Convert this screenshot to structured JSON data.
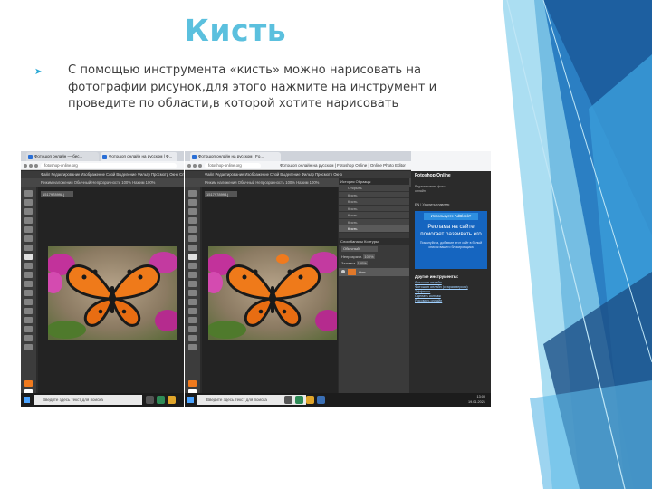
{
  "slide": {
    "title": "Кисть",
    "bullet": "С помощью инструмента «кисть» можно нарисовать на фотографии рисунок,для этого нажмите на инструмент и проведите по области,в которой хотите нарисовать"
  },
  "shot1": {
    "tab": "Фотошоп онлайн — бес...",
    "tab2": "Фотошоп онлайн на русском | Ф...",
    "url": "fotoshop-online.org",
    "app_menu": "Файл  Редактирование  Изображение  Слой  Выделение  Фильтр  Просмотр  Окно  Справка",
    "options": "Режим наложения  Обычный     Непрозрачность  100%    Нажим  100%",
    "doc_tab": "1517978998.j",
    "taskbar_search": "Введите здесь текст для поиска"
  },
  "shot2": {
    "tab": "Фотошоп онлайн на русском | Fo...",
    "url": "fotoshop-online.org",
    "page_title": "Фотошоп онлайн на русском | Fotoshop Online | Online Photo Editor",
    "app_menu": "Файл  Редактирование  Изображение  Слой  Выделение  Фильтр  Просмотр  Окно",
    "options": "Режим наложения  Обычный     Непрозрачность  100%    Нажим  100%",
    "doc_tab": "1517978998.j",
    "history_tabs": "История  Образцы",
    "history_items": [
      "Открыть",
      "Кисть",
      "Кисть",
      "Кисть",
      "Кисть",
      "Кисть",
      "Кисть"
    ],
    "layers_tabs": "Слои  Каналы  Контуры",
    "blend": "Обычный",
    "opacity_label": "Непрозрачн.",
    "opacity": "100%",
    "fill_label": "Заливка",
    "fill": "100%",
    "layer_name": "Фон",
    "taskbar_search": "Введите здесь текст для поиска",
    "clock": "13:00",
    "date": "19.01.2021"
  },
  "sidebar": {
    "brand": "Fotoshop Online",
    "brand_sub": "Редактировать фото онлайн",
    "lang": "EN | Удалить главную",
    "ad_label": "Используете AdBlock?",
    "ad_title": "Реклама на сайте помогает развивать его",
    "ad_text": "Пожалуйста, добавьте этот сайт в белый список вашего блокировщика",
    "other_tools": "Другие инструменты:",
    "links": [
      "Фотошоп онлайн",
      "Фотошоп онлайн (старая версия)",
      "Эффекты",
      "Сделать коллаж",
      "Рисовать онлайн"
    ]
  },
  "colors": {
    "title": "#5bc0de",
    "accent": "#2aa9d6",
    "ad_blue": "#1565c0",
    "panel_dark": "#2b2b2b"
  }
}
